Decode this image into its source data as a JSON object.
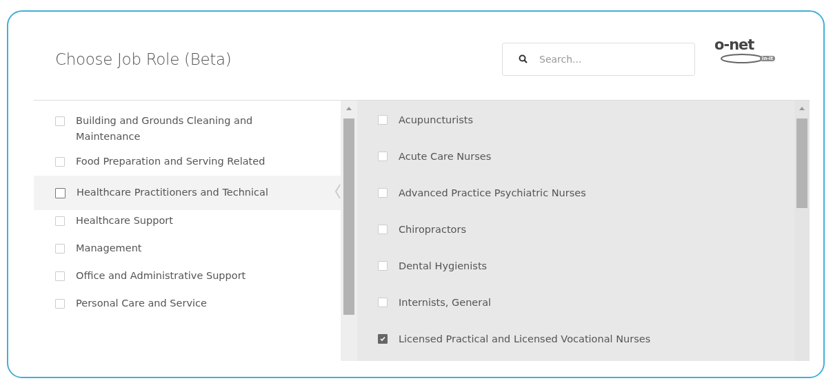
{
  "header": {
    "title": "Choose Job Role (Beta)",
    "search": {
      "placeholder": "Search..."
    },
    "logo": {
      "text": "o-net",
      "badge": "in-it"
    }
  },
  "categories": [
    {
      "label": "Building and Grounds Cleaning and Maintenance",
      "selected": false,
      "checked": false
    },
    {
      "label": "Food Preparation and Serving Related",
      "selected": false,
      "checked": false
    },
    {
      "label": "Healthcare Practitioners and Technical",
      "selected": true,
      "checked": false
    },
    {
      "label": "Healthcare Support",
      "selected": false,
      "checked": false
    },
    {
      "label": "Management",
      "selected": false,
      "checked": false
    },
    {
      "label": "Office and Administrative Support",
      "selected": false,
      "checked": false
    },
    {
      "label": "Personal Care and Service",
      "selected": false,
      "checked": false
    }
  ],
  "roles": [
    {
      "label": "Acupuncturists",
      "checked": false
    },
    {
      "label": "Acute Care Nurses",
      "checked": false
    },
    {
      "label": "Advanced Practice Psychiatric Nurses",
      "checked": false
    },
    {
      "label": "Chiropractors",
      "checked": false
    },
    {
      "label": "Dental Hygienists",
      "checked": false
    },
    {
      "label": "Internists, General",
      "checked": false
    },
    {
      "label": "Licensed Practical and Licensed Vocational Nurses",
      "checked": true
    }
  ]
}
